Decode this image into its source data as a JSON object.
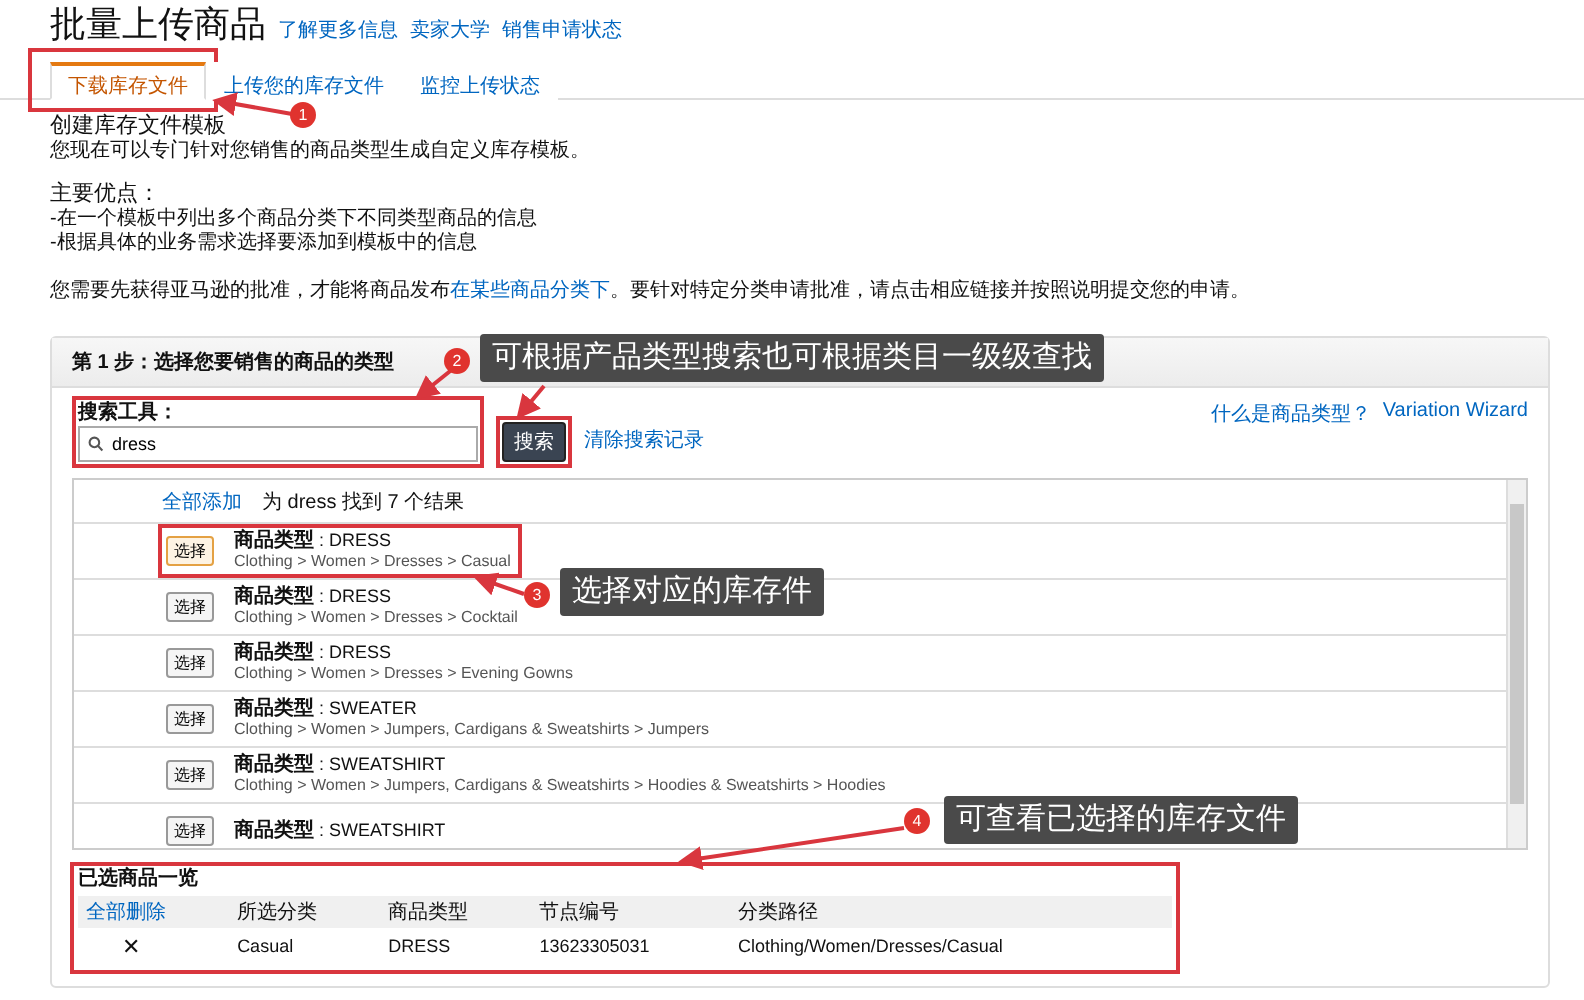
{
  "header": {
    "title": "批量上传商品",
    "links": [
      "了解更多信息",
      "卖家大学",
      "销售申请状态"
    ]
  },
  "tabs": [
    {
      "label": "下载库存文件",
      "selected": true
    },
    {
      "label": "上传您的库存文件",
      "selected": false
    },
    {
      "label": "监控上传状态",
      "selected": false
    }
  ],
  "intro": {
    "heading": "创建库存文件模板",
    "text": "您现在可以专门针对您销售的商品类型生成自定义库存模板。"
  },
  "benefits": {
    "heading": "主要优点：",
    "items": [
      "-在一个模板中列出多个商品分类下不同类型商品的信息",
      "-根据具体的业务需求选择要添加到模板中的信息"
    ]
  },
  "approval_note": {
    "before": "您需要先获得亚马逊的批准，才能将商品发布",
    "link": "在某些商品分类下",
    "after": "。要针对特定分类申请批准，请点击相应链接并按照说明提交您的申请。"
  },
  "step": {
    "title": "第 1 步：选择您要销售的商品的类型",
    "search_label": "搜索工具：",
    "search_value": "dress",
    "search_button": "搜索",
    "clear_link": "清除搜索记录",
    "help_link": "什么是商品类型？",
    "wizard_link": "Variation Wizard"
  },
  "results": {
    "add_all": "全部添加",
    "summary": "为 dress 找到 7 个结果",
    "rows": [
      {
        "button": "选择",
        "type": "**商品类型** : DRESS",
        "path": "Clothing > Women > Dresses > Casual",
        "selected": true
      },
      {
        "button": "选择",
        "type": "**商品类型** : DRESS",
        "path": "Clothing > Women > Dresses > Cocktail",
        "selected": false
      },
      {
        "button": "选择",
        "type": "**商品类型** : DRESS",
        "path": "Clothing > Women > Dresses > Evening Gowns",
        "selected": false
      },
      {
        "button": "选择",
        "type": "**商品类型** : SWEATER",
        "path": "Clothing > Women > Jumpers, Cardigans & Sweatshirts > Jumpers",
        "selected": false
      },
      {
        "button": "选择",
        "type": "**商品类型** : SWEATSHIRT",
        "path": "Clothing > Women > Jumpers, Cardigans & Sweatshirts > Hoodies & Sweatshirts > Hoodies",
        "selected": false
      },
      {
        "button": "选择",
        "type": "**商品类型** : SWEATSHIRT",
        "selected": false
      }
    ]
  },
  "selected_items": {
    "title": "已选商品一览",
    "remove_all": "全部删除",
    "columns": [
      "所选分类",
      "商品类型",
      "节点编号",
      "分类路径"
    ],
    "rows": [
      {
        "remove": "✕",
        "cells": [
          "Casual",
          "DRESS",
          "13623305031",
          "Clothing/Women/Dresses/Casual"
        ]
      }
    ]
  },
  "annotations": [
    {
      "number": "1"
    },
    {
      "number": "2",
      "text": "可根据产品类型搜索也可根据类目一级级查找"
    },
    {
      "number": "3",
      "text": "选择对应的库存件"
    },
    {
      "number": "4",
      "text": "可查看已选择的库存文件"
    }
  ]
}
